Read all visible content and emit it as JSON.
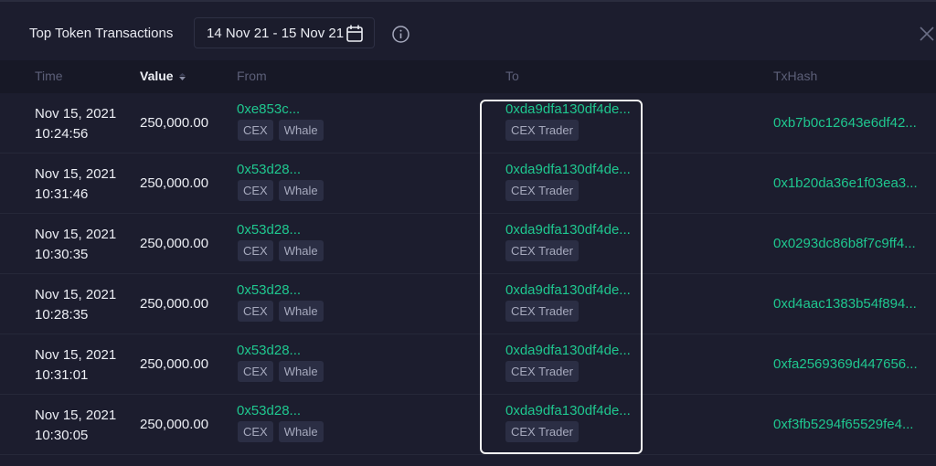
{
  "header": {
    "title": "Top Token Transactions",
    "date_range": "14 Nov 21 - 15 Nov 21"
  },
  "icons": {
    "calendar": "calendar-icon",
    "info": "info-icon",
    "close": "close-icon",
    "sort": "sort-down-icon"
  },
  "colors": {
    "address": "#1fc78f",
    "background": "#1c1d2e",
    "highlight": "#f2f2f2"
  },
  "columns": {
    "time": "Time",
    "value": "Value",
    "from": "From",
    "to": "To",
    "txhash": "TxHash"
  },
  "rows": [
    {
      "date": "Nov 15, 2021",
      "time": "10:24:56",
      "value": "250,000.00",
      "from": "0xe853c...",
      "from_tags": [
        "CEX",
        "Whale"
      ],
      "to": "0xda9dfa130df4de...",
      "to_tags": [
        "CEX Trader"
      ],
      "txhash": "0xb7b0c12643e6df42..."
    },
    {
      "date": "Nov 15, 2021",
      "time": "10:31:46",
      "value": "250,000.00",
      "from": "0x53d28...",
      "from_tags": [
        "CEX",
        "Whale"
      ],
      "to": "0xda9dfa130df4de...",
      "to_tags": [
        "CEX Trader"
      ],
      "txhash": "0x1b20da36e1f03ea3..."
    },
    {
      "date": "Nov 15, 2021",
      "time": "10:30:35",
      "value": "250,000.00",
      "from": "0x53d28...",
      "from_tags": [
        "CEX",
        "Whale"
      ],
      "to": "0xda9dfa130df4de...",
      "to_tags": [
        "CEX Trader"
      ],
      "txhash": "0x0293dc86b8f7c9ff4..."
    },
    {
      "date": "Nov 15, 2021",
      "time": "10:28:35",
      "value": "250,000.00",
      "from": "0x53d28...",
      "from_tags": [
        "CEX",
        "Whale"
      ],
      "to": "0xda9dfa130df4de...",
      "to_tags": [
        "CEX Trader"
      ],
      "txhash": "0xd4aac1383b54f894..."
    },
    {
      "date": "Nov 15, 2021",
      "time": "10:31:01",
      "value": "250,000.00",
      "from": "0x53d28...",
      "from_tags": [
        "CEX",
        "Whale"
      ],
      "to": "0xda9dfa130df4de...",
      "to_tags": [
        "CEX Trader"
      ],
      "txhash": "0xfa2569369d447656..."
    },
    {
      "date": "Nov 15, 2021",
      "time": "10:30:05",
      "value": "250,000.00",
      "from": "0x53d28...",
      "from_tags": [
        "CEX",
        "Whale"
      ],
      "to": "0xda9dfa130df4de...",
      "to_tags": [
        "CEX Trader"
      ],
      "txhash": "0xf3fb5294f65529fe4..."
    }
  ]
}
